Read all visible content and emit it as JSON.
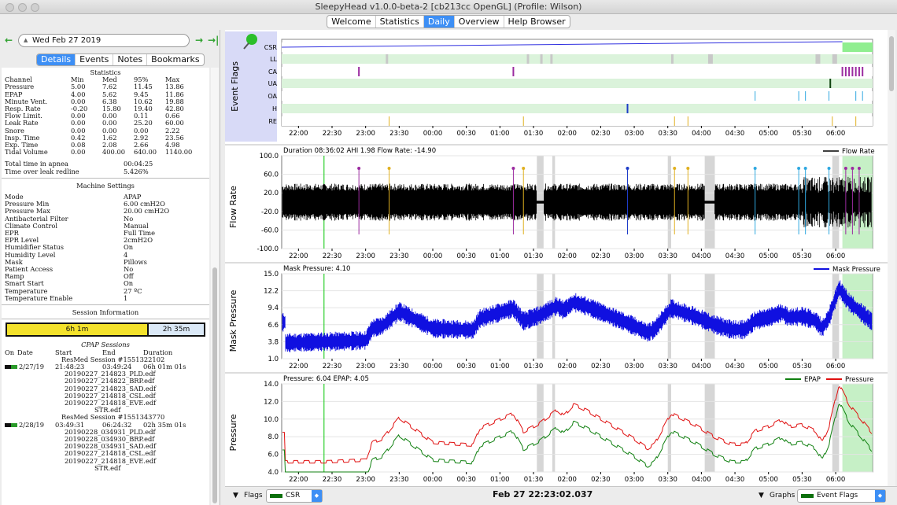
{
  "window": {
    "title": "SleepyHead v1.0.0-beta-2 [cb213cc OpenGL] (Profile: Wilson)"
  },
  "tabs": [
    "Welcome",
    "Statistics",
    "Daily",
    "Overview",
    "Help Browser"
  ],
  "date": "Wed Feb 27 2019",
  "subtabs": [
    "Details",
    "Events",
    "Notes",
    "Bookmarks"
  ],
  "stats": {
    "title": "Statistics",
    "header": [
      "Channel",
      "Min",
      "Med",
      "95%",
      "Max"
    ],
    "rows": [
      [
        "Pressure",
        "5.00",
        "7.62",
        "11.45",
        "13.86"
      ],
      [
        "EPAP",
        "4.00",
        "5.62",
        "9.45",
        "11.86"
      ],
      [
        "Minute Vent.",
        "0.00",
        "6.38",
        "10.62",
        "19.88"
      ],
      [
        "Resp. Rate",
        "-0.20",
        "15.80",
        "19.40",
        "42.80"
      ],
      [
        "Flow Limit.",
        "0.00",
        "0.00",
        "0.11",
        "0.66"
      ],
      [
        "Leak Rate",
        "0.00",
        "0.00",
        "25.20",
        "60.00"
      ],
      [
        "Snore",
        "0.00",
        "0.00",
        "0.00",
        "2.22"
      ],
      [
        "Insp. Time",
        "0.42",
        "1.62",
        "2.92",
        "23.56"
      ],
      [
        "Exp. Time",
        "0.08",
        "2.08",
        "2.66",
        "4.98"
      ],
      [
        "Tidal Volume",
        "0.00",
        "400.00",
        "640.00",
        "1140.00"
      ]
    ],
    "apnea_label": "Total time in apnea",
    "apnea_value": "00:04:25",
    "leak_label": "Time over leak redline",
    "leak_value": "5.426%"
  },
  "machine": {
    "title": "Machine Settings",
    "rows": [
      [
        "Mode",
        "APAP"
      ],
      [
        "Pressure Min",
        "6.00 cmH2O"
      ],
      [
        "Pressure Max",
        "20.00 cmH2O"
      ],
      [
        "Antibacterial Filter",
        "No"
      ],
      [
        "Climate Control",
        "Manual"
      ],
      [
        "EPR",
        "Full Time"
      ],
      [
        "EPR Level",
        "2cmH2O"
      ],
      [
        "Humidifier Status",
        "On"
      ],
      [
        "Humidity Level",
        "4"
      ],
      [
        "Mask",
        "Pillows"
      ],
      [
        "Patient Access",
        "No"
      ],
      [
        "Ramp",
        "Off"
      ],
      [
        "Smart Start",
        "On"
      ],
      [
        "Temperature",
        "27 ºC"
      ],
      [
        "Temperature Enable",
        "1"
      ]
    ]
  },
  "session_info": {
    "title": "Session Information",
    "bar1": "6h 1m",
    "bar2": "2h 35m"
  },
  "cpap": {
    "title": "CPAP Sessions",
    "header": [
      "On",
      "Date",
      "Start",
      "End",
      "Duration"
    ],
    "sessions": [
      {
        "name": "ResMed Session #1551322102",
        "date": "2/27/19",
        "start": "21:48:23",
        "end": "03:49:24",
        "duration": "06h 01m 01s",
        "files": [
          "20190227_214823_PLD.edf",
          "20190227_214822_BRP.edf",
          "20190227_214823_SAD.edf",
          "20190227_214818_CSL.edf",
          "20190227_214818_EVE.edf",
          "STR.edf"
        ]
      },
      {
        "name": "ResMed Session #1551343770",
        "date": "2/28/19",
        "start": "03:49:31",
        "end": "06:24:32",
        "duration": "02h 35m 01s",
        "files": [
          "20190228_034931_PLD.edf",
          "20190228_034930_BRP.edf",
          "20190228_034931_SAD.edf",
          "20190227_214818_CSL.edf",
          "20190227_214818_EVE.edf",
          "STR.edf"
        ]
      }
    ]
  },
  "graphs": {
    "event_flags": {
      "title": "Event Flags",
      "labels": [
        "CSR",
        "LL",
        "CA",
        "UA",
        "OA",
        "H",
        "RE"
      ]
    },
    "flow": {
      "title": "Flow Rate",
      "info": "Duration 08:36:02 AHI 1.98 Flow Rate: -14.90",
      "legend": "Flow Rate",
      "yticks": [
        "100.0",
        "60.0",
        "20.0",
        "-20.0",
        "-60.0",
        "-100.0"
      ]
    },
    "mask": {
      "title": "Mask Pressure",
      "info": "Mask Pressure: 4.10",
      "legend": "Mask Pressure",
      "yticks": [
        "15.0",
        "12.2",
        "9.4",
        "6.6",
        "3.8",
        "1.0"
      ]
    },
    "pressure": {
      "title": "Pressure",
      "info": "Pressure: 6.04 EPAP: 4.05",
      "legend1": "EPAP",
      "legend2": "Pressure",
      "yticks": [
        "14.0",
        "12.0",
        "10.0",
        "8.0",
        "6.0",
        "4.0"
      ]
    },
    "xticks": [
      "22:00",
      "22:30",
      "23:00",
      "23:30",
      "00:00",
      "00:30",
      "01:00",
      "01:30",
      "02:00",
      "02:30",
      "03:00",
      "03:30",
      "04:00",
      "04:30",
      "05:00",
      "05:30",
      "06:00"
    ]
  },
  "bottom": {
    "flags_label": "Flags",
    "flags_value": "CSR",
    "clock": "Feb 27 22:23:02.037",
    "graphs_label": "Graphs",
    "graphs_value": "Event Flags"
  },
  "colors": {
    "accent": "#3d8ff5",
    "flow": "#000000",
    "mask": "#1010e0",
    "pressure": "#e01010",
    "epap": "#108010",
    "csr": "#90ee90",
    "ll": "#cdebcd"
  }
}
